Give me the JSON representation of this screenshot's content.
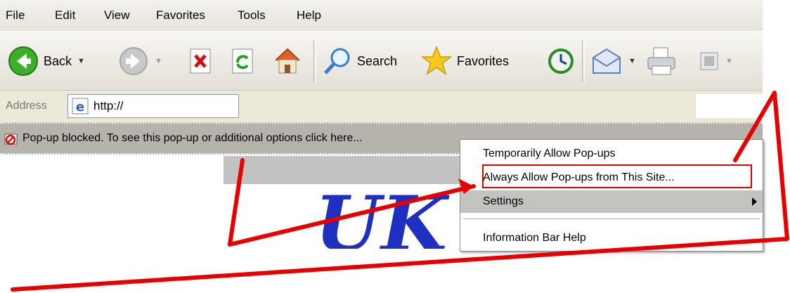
{
  "menubar": {
    "items": [
      "File",
      "Edit",
      "View",
      "Favorites",
      "Tools",
      "Help"
    ]
  },
  "toolbar": {
    "back_label": "Back",
    "search_label": "Search",
    "favorites_label": "Favorites"
  },
  "address": {
    "label": "Address",
    "value": "http://"
  },
  "infobar": {
    "message": "Pop-up blocked. To see this pop-up or additional options click here..."
  },
  "context_menu": {
    "items": [
      {
        "label": "Temporarily Allow Pop-ups"
      },
      {
        "label": "Always Allow Pop-ups from This Site..."
      },
      {
        "label": "Settings"
      },
      {
        "label": "Information Bar Help"
      }
    ]
  },
  "page": {
    "logo_text": "UK"
  },
  "colors": {
    "annotation": "#e00000",
    "infobar": "#b6b3ad",
    "logo": "#1f2fbf"
  },
  "icons": [
    "back-icon",
    "forward-icon",
    "stop-icon",
    "refresh-icon",
    "home-icon",
    "search-icon",
    "favorites-star-icon",
    "history-icon",
    "mail-icon",
    "print-icon",
    "edit-icon",
    "ie-page-icon",
    "popup-blocked-icon"
  ]
}
